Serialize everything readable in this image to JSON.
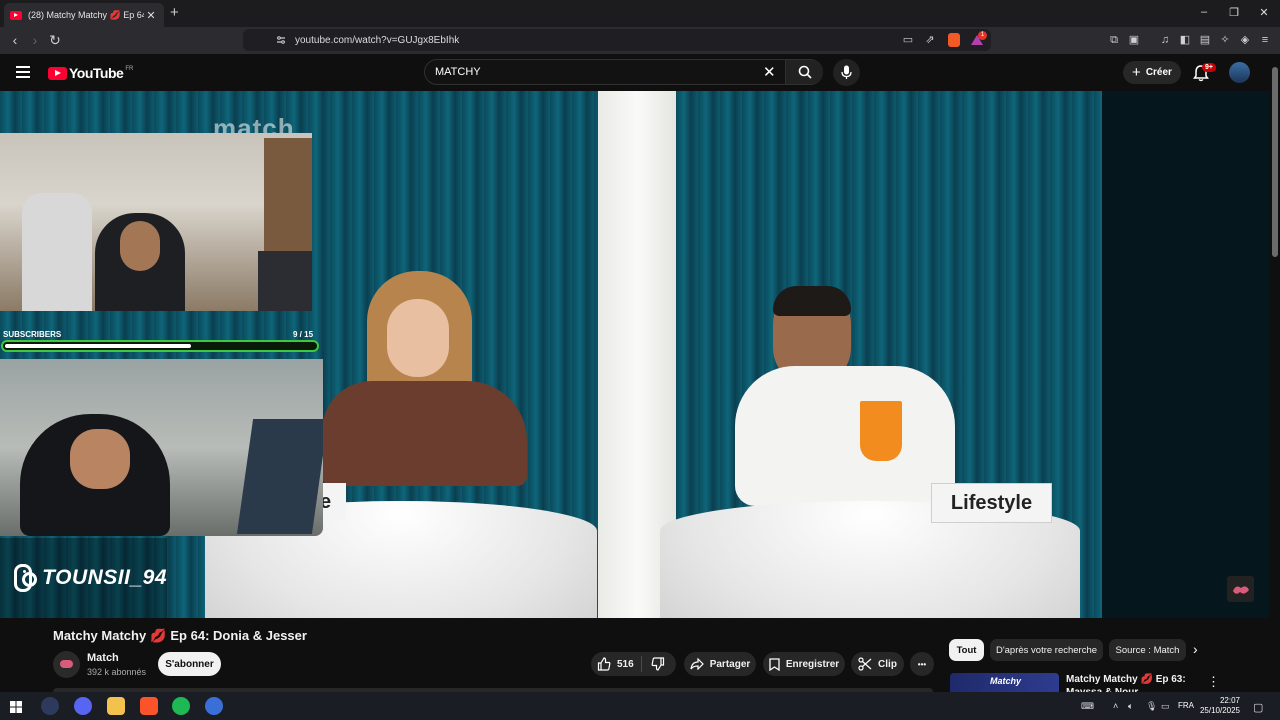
{
  "browser": {
    "tab_title": "(28) Matchy Matchy 💋 Ep 64: D",
    "new_tab": "+",
    "url": "youtube.com/watch?v=GUJgx8EbIhk",
    "window_controls": {
      "minimize": "–",
      "restore": "❐",
      "close": "✕"
    },
    "extension_badge": "1"
  },
  "youtube": {
    "logo_text": "YouTube",
    "country_code": "FR",
    "search_value": "MATCHY",
    "create_label": "Créer",
    "notification_count": "9+"
  },
  "video": {
    "watermark": "match",
    "name_card_right": "Lifestyle",
    "name_card_left": "e",
    "overlay": {
      "subscribers_label": "SUBSCRIBERS",
      "subscribers_progress": "9  / 15",
      "subscribers_fraction": 0.6,
      "instagram_handle": "TOUNSII_94"
    }
  },
  "meta": {
    "title_part1": "Matchy Matchy",
    "title_part2": "Ep 64: Donia & Jesser",
    "lips_emoji": "💋",
    "channel_name": "Match",
    "channel_subs": "392 k abonnés",
    "subscribe_label": "S'abonner",
    "like_count": "516",
    "share_label": "Partager",
    "save_label": "Enregistrer",
    "clip_label": "Clip",
    "more_label": "•••"
  },
  "sidebar": {
    "chips": [
      "Tout",
      "D'après votre recherche",
      "Source : Match"
    ],
    "related_title": "Matchy Matchy 💋 Ep 63: Mayssa & Nour",
    "related_thumb_text": "Matchy"
  },
  "taskbar": {
    "language": "FRA",
    "time": "22:07",
    "date": "25/10/2025"
  },
  "colors": {
    "youtube_red": "#ff0033",
    "progress_border": "#3fc83f",
    "curtain": "#0d5a6d"
  }
}
